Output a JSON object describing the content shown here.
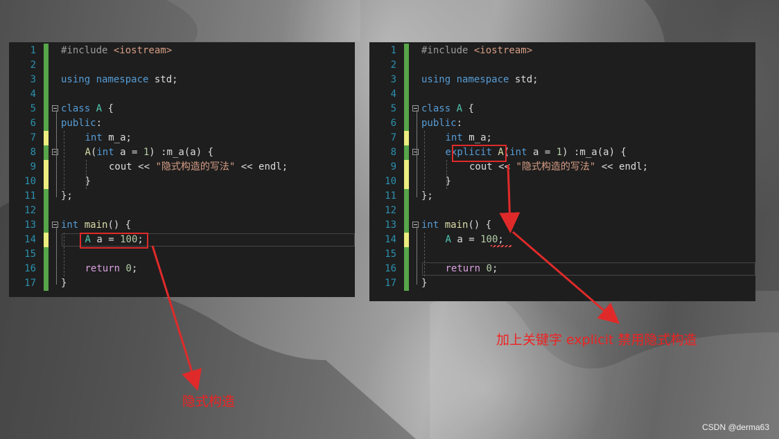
{
  "left_editor": {
    "lines": [
      {
        "n": "1",
        "mark": "green",
        "fold": false,
        "indent": 0,
        "tokens": [
          [
            "pp",
            "#include "
          ],
          [
            "inc",
            "<iostream>"
          ]
        ]
      },
      {
        "n": "2",
        "mark": "green",
        "fold": false,
        "indent": 0,
        "tokens": []
      },
      {
        "n": "3",
        "mark": "green",
        "fold": false,
        "indent": 0,
        "tokens": [
          [
            "kw",
            "using"
          ],
          [
            "pl",
            " "
          ],
          [
            "kw",
            "namespace"
          ],
          [
            "pl",
            " std;"
          ]
        ]
      },
      {
        "n": "4",
        "mark": "green",
        "fold": false,
        "indent": 0,
        "tokens": []
      },
      {
        "n": "5",
        "mark": "green",
        "fold": true,
        "indent": 0,
        "tokens": [
          [
            "kw",
            "class"
          ],
          [
            "pl",
            " "
          ],
          [
            "ty",
            "A"
          ],
          [
            "pl",
            " {"
          ]
        ]
      },
      {
        "n": "6",
        "mark": "green",
        "fold": false,
        "indent": 0,
        "tokens": [
          [
            "kw",
            "public"
          ],
          [
            "pl",
            ":"
          ]
        ]
      },
      {
        "n": "7",
        "mark": "yellow",
        "fold": false,
        "indent": 1,
        "tokens": [
          [
            "kw",
            "int"
          ],
          [
            "pl",
            " m_a;"
          ]
        ]
      },
      {
        "n": "8",
        "mark": "green",
        "fold": true,
        "indent": 1,
        "tokens": [
          [
            "fn",
            "A"
          ],
          [
            "pl",
            "("
          ],
          [
            "kw",
            "int"
          ],
          [
            "pl",
            " a = "
          ],
          [
            "num",
            "1"
          ],
          [
            "pl",
            ") :m_a(a) {"
          ]
        ]
      },
      {
        "n": "9",
        "mark": "yellow",
        "fold": false,
        "indent": 2,
        "tokens": [
          [
            "pl",
            "cout << "
          ],
          [
            "str",
            "\"隐式构造的写法\""
          ],
          [
            "pl",
            " << endl;"
          ]
        ]
      },
      {
        "n": "10",
        "mark": "yellow",
        "fold": false,
        "indent": 1,
        "tokens": [
          [
            "pl",
            "}"
          ]
        ]
      },
      {
        "n": "11",
        "mark": "green",
        "fold": false,
        "indent": 0,
        "tokens": [
          [
            "pl",
            "};"
          ]
        ]
      },
      {
        "n": "12",
        "mark": "green",
        "fold": false,
        "indent": 0,
        "tokens": []
      },
      {
        "n": "13",
        "mark": "green",
        "fold": true,
        "indent": 0,
        "tokens": [
          [
            "kw",
            "int"
          ],
          [
            "pl",
            " "
          ],
          [
            "fn",
            "main"
          ],
          [
            "pl",
            "() {"
          ]
        ]
      },
      {
        "n": "14",
        "mark": "yellow",
        "fold": false,
        "indent": 1,
        "tokens": [
          [
            "ty",
            "A"
          ],
          [
            "pl",
            " a = "
          ],
          [
            "num",
            "100"
          ],
          [
            "pl",
            ";"
          ]
        ]
      },
      {
        "n": "15",
        "mark": "green",
        "fold": false,
        "indent": 0,
        "tokens": []
      },
      {
        "n": "16",
        "mark": "green",
        "fold": false,
        "indent": 1,
        "tokens": [
          [
            "ctl",
            "return"
          ],
          [
            "pl",
            " "
          ],
          [
            "num",
            "0"
          ],
          [
            "pl",
            ";"
          ]
        ]
      },
      {
        "n": "17",
        "mark": "green",
        "fold": false,
        "indent": 0,
        "tokens": [
          [
            "pl",
            "}"
          ]
        ]
      }
    ]
  },
  "right_editor": {
    "lines": [
      {
        "n": "1",
        "mark": "green",
        "fold": false,
        "indent": 0,
        "tokens": [
          [
            "pp",
            "#include "
          ],
          [
            "inc",
            "<iostream>"
          ]
        ]
      },
      {
        "n": "2",
        "mark": "green",
        "fold": false,
        "indent": 0,
        "tokens": []
      },
      {
        "n": "3",
        "mark": "green",
        "fold": false,
        "indent": 0,
        "tokens": [
          [
            "kw",
            "using"
          ],
          [
            "pl",
            " "
          ],
          [
            "kw",
            "namespace"
          ],
          [
            "pl",
            " std;"
          ]
        ]
      },
      {
        "n": "4",
        "mark": "green",
        "fold": false,
        "indent": 0,
        "tokens": []
      },
      {
        "n": "5",
        "mark": "green",
        "fold": true,
        "indent": 0,
        "tokens": [
          [
            "kw",
            "class"
          ],
          [
            "pl",
            " "
          ],
          [
            "ty",
            "A"
          ],
          [
            "pl",
            " {"
          ]
        ]
      },
      {
        "n": "6",
        "mark": "green",
        "fold": false,
        "indent": 0,
        "tokens": [
          [
            "kw",
            "public"
          ],
          [
            "pl",
            ":"
          ]
        ]
      },
      {
        "n": "7",
        "mark": "yellow",
        "fold": false,
        "indent": 1,
        "tokens": [
          [
            "kw",
            "int"
          ],
          [
            "pl",
            " m_a;"
          ]
        ]
      },
      {
        "n": "8",
        "mark": "green",
        "fold": true,
        "indent": 1,
        "tokens": [
          [
            "kw",
            "explicit"
          ],
          [
            "pl",
            " "
          ],
          [
            "fn",
            "A"
          ],
          [
            "pl",
            "("
          ],
          [
            "kw",
            "int"
          ],
          [
            "pl",
            " a = "
          ],
          [
            "num",
            "1"
          ],
          [
            "pl",
            ") :m_a(a) {"
          ]
        ]
      },
      {
        "n": "9",
        "mark": "yellow",
        "fold": false,
        "indent": 2,
        "tokens": [
          [
            "pl",
            "cout << "
          ],
          [
            "str",
            "\"隐式构造的写法\""
          ],
          [
            "pl",
            " << endl;"
          ]
        ]
      },
      {
        "n": "10",
        "mark": "yellow",
        "fold": false,
        "indent": 1,
        "tokens": [
          [
            "pl",
            "}"
          ]
        ]
      },
      {
        "n": "11",
        "mark": "green",
        "fold": false,
        "indent": 0,
        "tokens": [
          [
            "pl",
            "};"
          ]
        ]
      },
      {
        "n": "12",
        "mark": "green",
        "fold": false,
        "indent": 0,
        "tokens": []
      },
      {
        "n": "13",
        "mark": "green",
        "fold": true,
        "indent": 0,
        "tokens": [
          [
            "kw",
            "int"
          ],
          [
            "pl",
            " "
          ],
          [
            "fn",
            "main"
          ],
          [
            "pl",
            "() {"
          ]
        ]
      },
      {
        "n": "14",
        "mark": "yellow",
        "fold": false,
        "indent": 1,
        "tokens": [
          [
            "ty",
            "A"
          ],
          [
            "pl",
            " a = "
          ],
          [
            "num",
            "100"
          ],
          [
            "pl",
            ";"
          ]
        ]
      },
      {
        "n": "15",
        "mark": "green",
        "fold": false,
        "indent": 0,
        "tokens": []
      },
      {
        "n": "16",
        "mark": "green",
        "fold": false,
        "indent": 1,
        "tokens": [
          [
            "ctl",
            "return"
          ],
          [
            "pl",
            " "
          ],
          [
            "num",
            "0"
          ],
          [
            "pl",
            ";"
          ]
        ]
      },
      {
        "n": "17",
        "mark": "green",
        "fold": false,
        "indent": 0,
        "tokens": [
          [
            "pl",
            "}"
          ]
        ]
      }
    ]
  },
  "annotations": {
    "implicit": "隐式构造",
    "explicit": "加上关键字 explicit 禁用隐式构造"
  },
  "watermark": "CSDN @derma63",
  "colors": {
    "annotation_red": "#e02a2a",
    "editor_bg": "#1e1e1e",
    "line_number": "#2b91af",
    "change_green": "#57a64a",
    "change_yellow": "#eded80"
  }
}
